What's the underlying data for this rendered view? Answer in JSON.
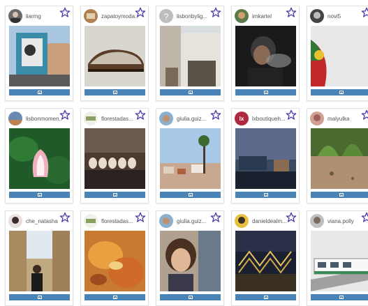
{
  "grid": {
    "cards": [
      {
        "username": "liarmg"
      },
      {
        "username": "zapatoymoda..."
      },
      {
        "username": "lisbonbylig..."
      },
      {
        "username": "imkartel"
      },
      {
        "username": "novi5"
      },
      {
        "username": "lisbonmomen..."
      },
      {
        "username": "florestadas..."
      },
      {
        "username": "giulia.guiz..."
      },
      {
        "username": "lxboutiqueh..."
      },
      {
        "username": "malyulka"
      },
      {
        "username": "che_natasha"
      },
      {
        "username": "florestadas..."
      },
      {
        "username": "giulia.guiz..."
      },
      {
        "username": "danieldealm..."
      },
      {
        "username": "viana.polly"
      }
    ]
  },
  "icons": {
    "favorite": "star-outline-icon",
    "view": "image-icon"
  },
  "colors": {
    "star": "#4b3aa8",
    "bar": "#4a84b7"
  }
}
